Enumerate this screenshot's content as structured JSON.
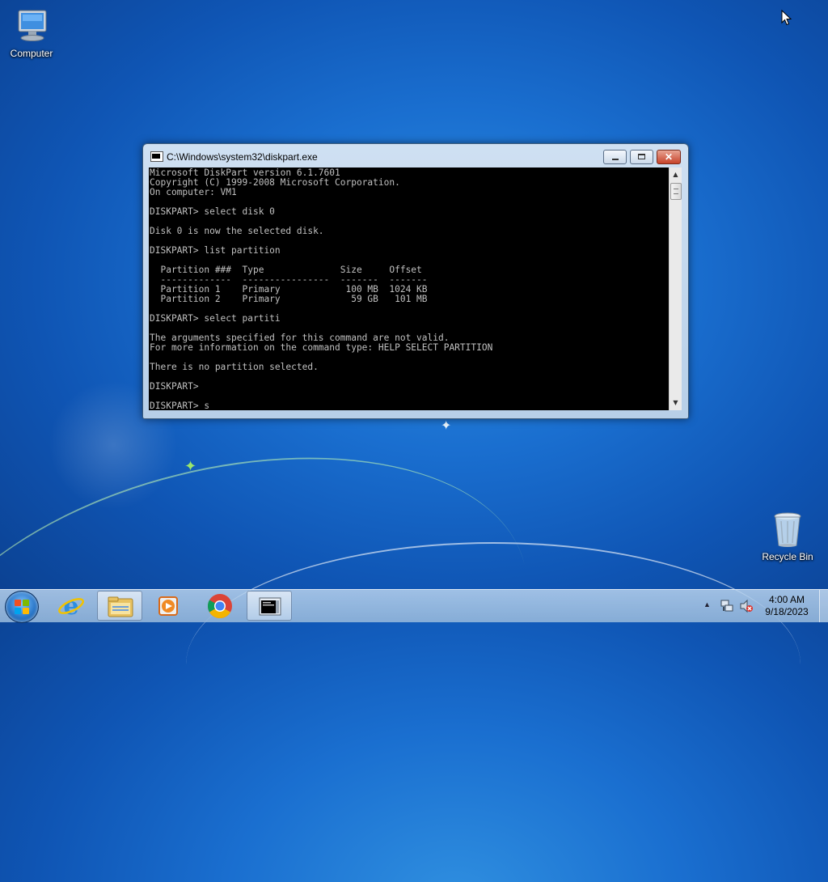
{
  "desktop": {
    "icons": [
      {
        "label": "Computer",
        "icon": "computer-icon"
      },
      {
        "label": "Recycle Bin",
        "icon": "recycle-bin-icon"
      }
    ]
  },
  "window": {
    "title": "C:\\Windows\\system32\\diskpart.exe",
    "icon": "console-icon",
    "buttons": {
      "minimize": "minimize-button",
      "maximize": "maximize-button",
      "close": "close-button"
    }
  },
  "console": {
    "lines": [
      "Microsoft DiskPart version 6.1.7601",
      "Copyright (C) 1999-2008 Microsoft Corporation.",
      "On computer: VM1",
      "",
      "DISKPART> select disk 0",
      "",
      "Disk 0 is now the selected disk.",
      "",
      "DISKPART> list partition",
      "",
      "  Partition ###  Type              Size     Offset",
      "  -------------  ----------------  -------  -------",
      "  Partition 1    Primary            100 MB  1024 KB",
      "  Partition 2    Primary             59 GB   101 MB",
      "",
      "DISKPART> select partiti",
      "",
      "The arguments specified for this command are not valid.",
      "For more information on the command type: HELP SELECT PARTITION",
      "",
      "There is no partition selected.",
      "",
      "DISKPART>",
      "",
      "DISKPART> s"
    ]
  },
  "taskbar": {
    "start": "start-button",
    "pinned": [
      {
        "name": "internet-explorer",
        "icon": "internet-explorer-icon"
      },
      {
        "name": "file-explorer",
        "icon": "folder-icon",
        "active": true
      },
      {
        "name": "media-player",
        "icon": "media-player-icon"
      },
      {
        "name": "chrome",
        "icon": "chrome-icon"
      },
      {
        "name": "diskpart-console",
        "icon": "console-icon",
        "active": true
      }
    ],
    "tray": {
      "icons": [
        "show-hidden-icons-arrow",
        "network-icon",
        "volume-muted-icon"
      ],
      "time": "4:00 AM",
      "date": "9/18/2023"
    }
  },
  "colors": {
    "desktop_bg": "#1a6fd0",
    "console_bg": "#000000",
    "console_fg": "#c0c0c0",
    "close_red": "#c7432a"
  }
}
